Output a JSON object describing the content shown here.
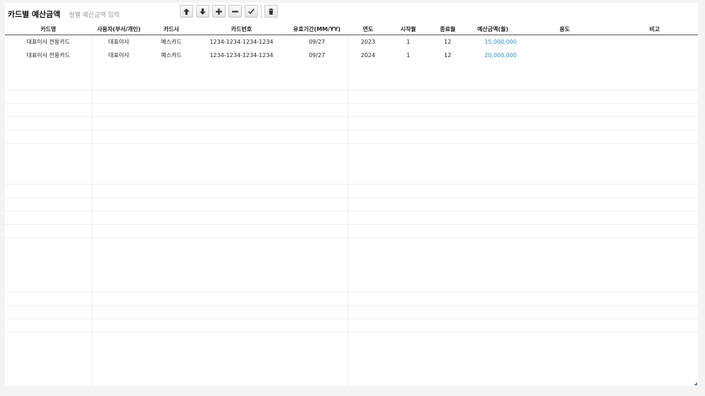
{
  "header": {
    "title": "카드별 예산금액",
    "subtitle": "월별 예산금액 입력"
  },
  "toolbar": {
    "buttons": [
      {
        "name": "move-up-button",
        "icon": "arrow-up-icon"
      },
      {
        "name": "move-down-button",
        "icon": "arrow-down-icon"
      },
      {
        "name": "add-row-button",
        "icon": "plus-icon"
      },
      {
        "name": "remove-row-button",
        "icon": "minus-icon"
      },
      {
        "name": "confirm-button",
        "icon": "check-icon"
      },
      {
        "name": "delete-button",
        "icon": "trash-icon"
      }
    ]
  },
  "table": {
    "columns": [
      "카드명",
      "사용자(부서/개인)",
      "카드사",
      "카드번호",
      "유효기간(MM/YY)",
      "연도",
      "시작월",
      "종료월",
      "예산금액(월)",
      "용도",
      "비고"
    ],
    "rows": [
      [
        "대표이사 전용카드",
        "대표이사",
        "예스카드",
        "1234-1234-1234-1234",
        "09/27",
        "2023",
        "1",
        "12",
        "15,000,000",
        "",
        ""
      ],
      [
        "대표이사 전용카드",
        "대표이사",
        "예스카드",
        "1234-1234-1234-1234",
        "09/27",
        "2024",
        "1",
        "12",
        "20,000,000",
        "",
        ""
      ]
    ]
  },
  "colors": {
    "amount": "#2a8fc7",
    "header_border": "#555555"
  }
}
